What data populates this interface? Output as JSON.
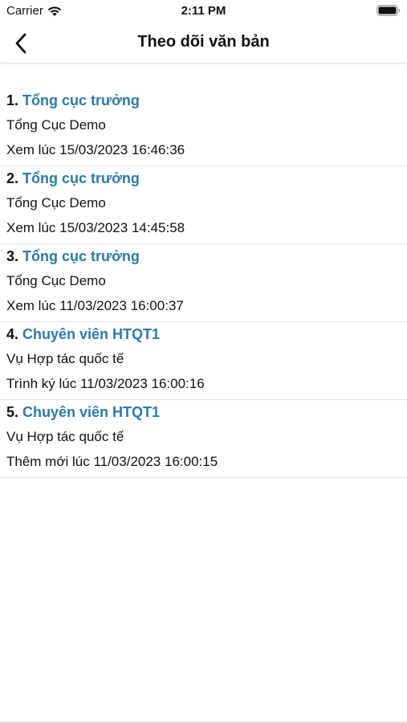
{
  "status_bar": {
    "carrier": "Carrier",
    "time": "2:11 PM"
  },
  "nav": {
    "title": "Theo dõi văn bản"
  },
  "colors": {
    "name_link": "#2a7ab0"
  },
  "items": [
    {
      "index": "1.",
      "name": "Tổng cục trưởng",
      "org": "Tổng Cục Demo",
      "time": "Xem lúc 15/03/2023 16:46:36"
    },
    {
      "index": "2.",
      "name": "Tổng cục trưởng",
      "org": "Tổng Cục Demo",
      "time": "Xem lúc 15/03/2023 14:45:58"
    },
    {
      "index": "3.",
      "name": "Tổng cục trưởng",
      "org": "Tổng Cục Demo",
      "time": "Xem lúc 11/03/2023 16:00:37"
    },
    {
      "index": "4.",
      "name": "Chuyên viên HTQT1",
      "org": "Vụ Hợp tác quốc tế",
      "time": "Trình ký lúc 11/03/2023 16:00:16"
    },
    {
      "index": "5.",
      "name": "Chuyên viên HTQT1",
      "org": "Vụ Hợp tác quốc tế",
      "time": "Thêm mới lúc 11/03/2023 16:00:15"
    }
  ]
}
